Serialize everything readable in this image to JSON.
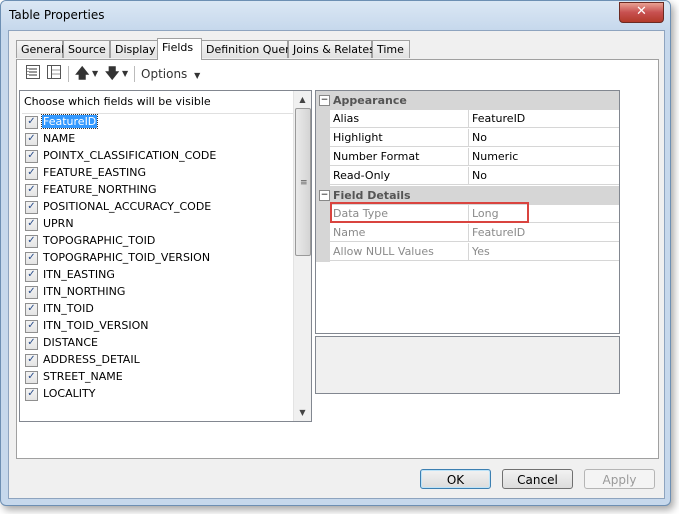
{
  "window": {
    "title": "Table Properties",
    "close_label": "✕"
  },
  "tabs": [
    "General",
    "Source",
    "Display",
    "Fields",
    "Definition Query",
    "Joins & Relates",
    "Time"
  ],
  "toolbar": {
    "up_arrow": "🡅",
    "down_arrow": "🡇",
    "options_label": "Options"
  },
  "fieldlist": {
    "header": "Choose which fields will be visible",
    "fields": [
      {
        "name": "FeatureID",
        "checked": true,
        "selected": true
      },
      {
        "name": "NAME",
        "checked": true
      },
      {
        "name": "POINTX_CLASSIFICATION_CODE",
        "checked": true
      },
      {
        "name": "FEATURE_EASTING",
        "checked": true
      },
      {
        "name": "FEATURE_NORTHING",
        "checked": true
      },
      {
        "name": "POSITIONAL_ACCURACY_CODE",
        "checked": true
      },
      {
        "name": "UPRN",
        "checked": true
      },
      {
        "name": "TOPOGRAPHIC_TOID",
        "checked": true
      },
      {
        "name": "TOPOGRAPHIC_TOID_VERSION",
        "checked": true
      },
      {
        "name": "ITN_EASTING",
        "checked": true
      },
      {
        "name": "ITN_NORTHING",
        "checked": true
      },
      {
        "name": "ITN_TOID",
        "checked": true
      },
      {
        "name": "ITN_TOID_VERSION",
        "checked": true
      },
      {
        "name": "DISTANCE",
        "checked": true
      },
      {
        "name": "ADDRESS_DETAIL",
        "checked": true
      },
      {
        "name": "STREET_NAME",
        "checked": true
      },
      {
        "name": "LOCALITY",
        "checked": true
      }
    ]
  },
  "properties": {
    "appearance_label": "Appearance",
    "appearance": [
      {
        "name": "Alias",
        "value": "FeatureID"
      },
      {
        "name": "Highlight",
        "value": "No"
      },
      {
        "name": "Number Format",
        "value": "Numeric"
      },
      {
        "name": "Read-Only",
        "value": "No"
      }
    ],
    "details_label": "Field Details",
    "details": [
      {
        "name": "Data Type",
        "value": "Long"
      },
      {
        "name": "Name",
        "value": "FeatureID"
      },
      {
        "name": "Allow NULL Values",
        "value": "Yes"
      }
    ]
  },
  "buttons": {
    "ok": "OK",
    "cancel": "Cancel",
    "apply": "Apply"
  },
  "colors": {
    "accent": "#3399ff",
    "highlight_box": "#d9443f"
  }
}
